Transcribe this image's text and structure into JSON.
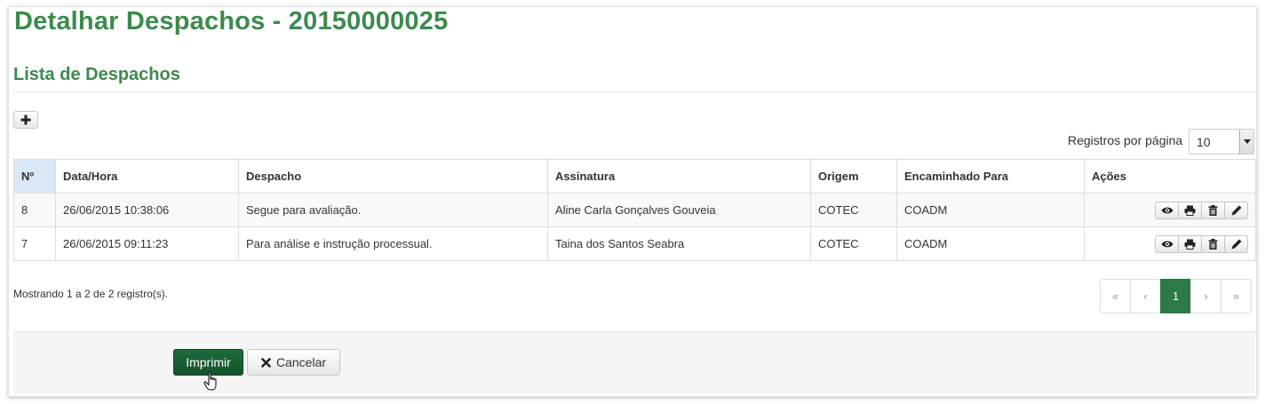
{
  "page": {
    "title": "Detalhar Despachos - 20150000025",
    "section_title": "Lista de Despachos"
  },
  "toolbar": {
    "add_icon": "plus-icon"
  },
  "per_page": {
    "label": "Registros por página",
    "value": "10"
  },
  "table": {
    "headers": [
      "Nº",
      "Data/Hora",
      "Despacho",
      "Assinatura",
      "Origem",
      "Encaminhado Para",
      "Ações"
    ],
    "rows": [
      {
        "num": "8",
        "datetime": "26/06/2015 10:38:06",
        "despacho": "Segue para avaliação.",
        "assinatura": "Aline Carla Gonçalves Gouveia",
        "origem": "COTEC",
        "encaminhado": "COADM"
      },
      {
        "num": "7",
        "datetime": "26/06/2015 09:11:23",
        "despacho": "Para análise e instrução processual.",
        "assinatura": "Taina dos Santos Seabra",
        "origem": "COTEC",
        "encaminhado": "COADM"
      }
    ],
    "row_actions": [
      "eye-icon",
      "print-icon",
      "trash-icon",
      "pencil-icon"
    ]
  },
  "summary": "Mostrando 1 a 2 de 2 registro(s).",
  "pagination": {
    "first": "«",
    "prev": "‹",
    "current": "1",
    "next": "›",
    "last": "»"
  },
  "footer": {
    "print_label": "Imprimir",
    "cancel_label": "Cancelar",
    "cancel_icon": "close-icon"
  },
  "colors": {
    "title_green": "#3c8a4e",
    "primary_button": "#1e6a3b",
    "active_page": "#2e7a47",
    "sorted_header": "#dbe9f6"
  }
}
